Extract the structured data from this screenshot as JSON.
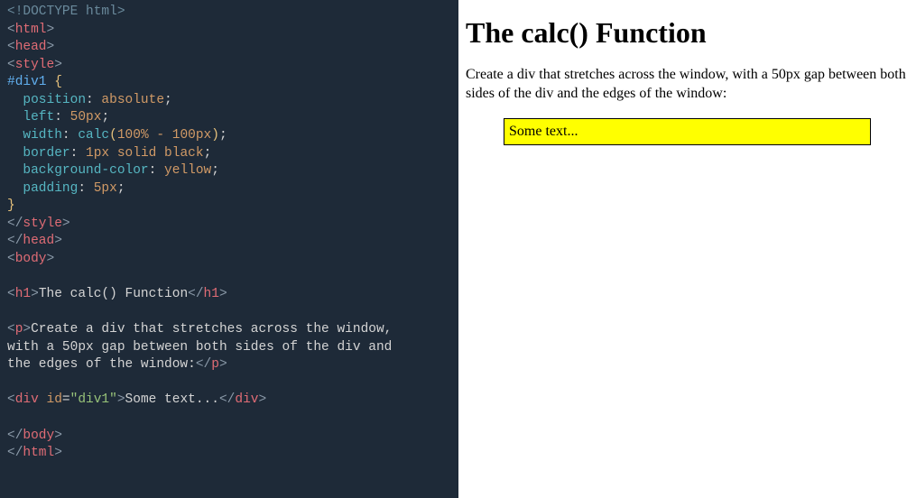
{
  "code": {
    "lines": [
      [
        {
          "t": "<!DOCTYPE html>",
          "c": "c-doctype"
        }
      ],
      [
        {
          "t": "<",
          "c": "c-angle"
        },
        {
          "t": "html",
          "c": "c-tag"
        },
        {
          "t": ">",
          "c": "c-angle"
        }
      ],
      [
        {
          "t": "<",
          "c": "c-angle"
        },
        {
          "t": "head",
          "c": "c-tag"
        },
        {
          "t": ">",
          "c": "c-angle"
        }
      ],
      [
        {
          "t": "<",
          "c": "c-angle"
        },
        {
          "t": "style",
          "c": "c-tag"
        },
        {
          "t": ">",
          "c": "c-angle"
        }
      ],
      [
        {
          "t": "#div1 ",
          "c": "c-selector"
        },
        {
          "t": "{",
          "c": "c-brace"
        }
      ],
      [
        {
          "t": "  position",
          "c": "c-prop"
        },
        {
          "t": ": ",
          "c": "c-text"
        },
        {
          "t": "absolute",
          "c": "c-val"
        },
        {
          "t": ";",
          "c": "c-text"
        }
      ],
      [
        {
          "t": "  left",
          "c": "c-prop"
        },
        {
          "t": ": ",
          "c": "c-text"
        },
        {
          "t": "50px",
          "c": "c-val"
        },
        {
          "t": ";",
          "c": "c-text"
        }
      ],
      [
        {
          "t": "  width",
          "c": "c-prop"
        },
        {
          "t": ": ",
          "c": "c-text"
        },
        {
          "t": "calc",
          "c": "c-prop"
        },
        {
          "t": "(",
          "c": "c-brace"
        },
        {
          "t": "100% - 100px",
          "c": "c-val"
        },
        {
          "t": ")",
          "c": "c-brace"
        },
        {
          "t": ";",
          "c": "c-text"
        }
      ],
      [
        {
          "t": "  border",
          "c": "c-prop"
        },
        {
          "t": ": ",
          "c": "c-text"
        },
        {
          "t": "1px solid black",
          "c": "c-val"
        },
        {
          "t": ";",
          "c": "c-text"
        }
      ],
      [
        {
          "t": "  background-color",
          "c": "c-prop"
        },
        {
          "t": ": ",
          "c": "c-text"
        },
        {
          "t": "yellow",
          "c": "c-val"
        },
        {
          "t": ";",
          "c": "c-text"
        }
      ],
      [
        {
          "t": "  padding",
          "c": "c-prop"
        },
        {
          "t": ": ",
          "c": "c-text"
        },
        {
          "t": "5px",
          "c": "c-val"
        },
        {
          "t": ";",
          "c": "c-text"
        }
      ],
      [
        {
          "t": "}",
          "c": "c-brace"
        }
      ],
      [
        {
          "t": "</",
          "c": "c-angle"
        },
        {
          "t": "style",
          "c": "c-tag"
        },
        {
          "t": ">",
          "c": "c-angle"
        }
      ],
      [
        {
          "t": "</",
          "c": "c-angle"
        },
        {
          "t": "head",
          "c": "c-tag"
        },
        {
          "t": ">",
          "c": "c-angle"
        }
      ],
      [
        {
          "t": "<",
          "c": "c-angle"
        },
        {
          "t": "body",
          "c": "c-tag"
        },
        {
          "t": ">",
          "c": "c-angle"
        }
      ],
      [],
      [
        {
          "t": "<",
          "c": "c-angle"
        },
        {
          "t": "h1",
          "c": "c-tag"
        },
        {
          "t": ">",
          "c": "c-angle"
        },
        {
          "t": "The calc() Function",
          "c": "c-text"
        },
        {
          "t": "</",
          "c": "c-angle"
        },
        {
          "t": "h1",
          "c": "c-tag"
        },
        {
          "t": ">",
          "c": "c-angle"
        }
      ],
      [],
      [
        {
          "t": "<",
          "c": "c-angle"
        },
        {
          "t": "p",
          "c": "c-tag"
        },
        {
          "t": ">",
          "c": "c-angle"
        },
        {
          "t": "Create a div that stretches across the window,",
          "c": "c-text"
        }
      ],
      [
        {
          "t": "with a 50px gap between both sides of the div and",
          "c": "c-text"
        }
      ],
      [
        {
          "t": "the edges of the window:",
          "c": "c-text"
        },
        {
          "t": "</",
          "c": "c-angle"
        },
        {
          "t": "p",
          "c": "c-tag"
        },
        {
          "t": ">",
          "c": "c-angle"
        }
      ],
      [],
      [
        {
          "t": "<",
          "c": "c-angle"
        },
        {
          "t": "div ",
          "c": "c-tag"
        },
        {
          "t": "id",
          "c": "c-attr"
        },
        {
          "t": "=",
          "c": "c-text"
        },
        {
          "t": "\"div1\"",
          "c": "c-str"
        },
        {
          "t": ">",
          "c": "c-angle"
        },
        {
          "t": "Some text...",
          "c": "c-text"
        },
        {
          "t": "</",
          "c": "c-angle"
        },
        {
          "t": "div",
          "c": "c-tag"
        },
        {
          "t": ">",
          "c": "c-angle"
        }
      ],
      [],
      [
        {
          "t": "</",
          "c": "c-angle"
        },
        {
          "t": "body",
          "c": "c-tag"
        },
        {
          "t": ">",
          "c": "c-angle"
        }
      ],
      [
        {
          "t": "</",
          "c": "c-angle"
        },
        {
          "t": "html",
          "c": "c-tag"
        },
        {
          "t": ">",
          "c": "c-angle"
        }
      ]
    ]
  },
  "preview": {
    "heading": "The calc() Function",
    "paragraph": "Create a div that stretches across the window, with a 50px gap between both sides of the div and the edges of the window:",
    "div_text": "Some text..."
  }
}
